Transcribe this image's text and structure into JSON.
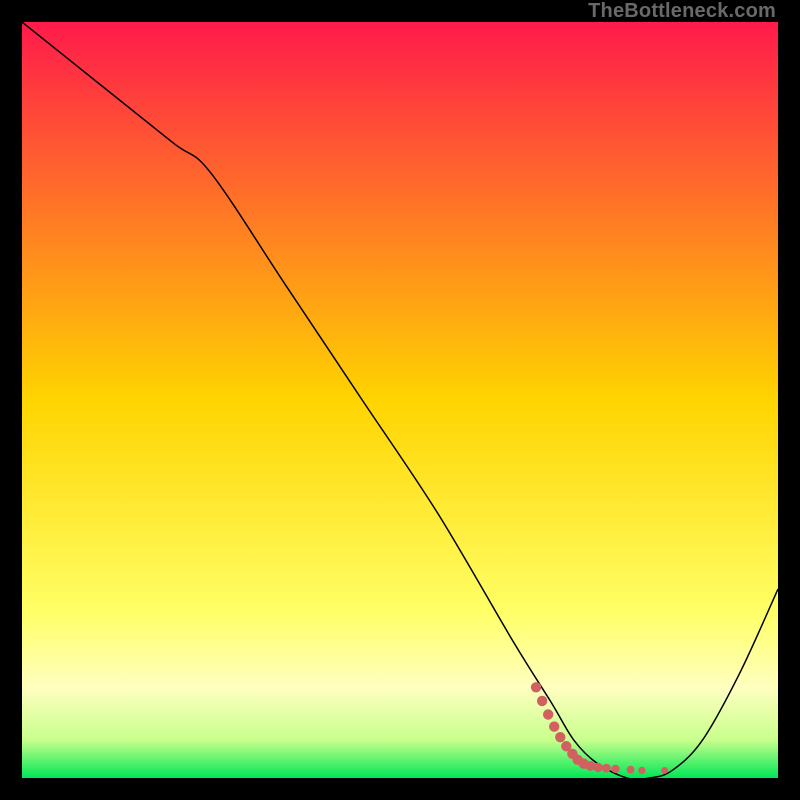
{
  "watermark": "TheBottleneck.com",
  "chart_data": {
    "type": "line",
    "title": "",
    "xlabel": "",
    "ylabel": "",
    "xlim": [
      0,
      100
    ],
    "ylim": [
      0,
      100
    ],
    "grid": false,
    "legend": false,
    "background_gradient": {
      "stops": [
        {
          "offset": 0.0,
          "color": "#ff1a4b"
        },
        {
          "offset": 0.5,
          "color": "#ffd400"
        },
        {
          "offset": 0.78,
          "color": "#ffff66"
        },
        {
          "offset": 0.88,
          "color": "#ffffc0"
        },
        {
          "offset": 0.95,
          "color": "#c8ff8c"
        },
        {
          "offset": 1.0,
          "color": "#00e756"
        }
      ]
    },
    "series": [
      {
        "name": "bottleneck-curve",
        "stroke": "#000000",
        "stroke_width": 1.5,
        "x": [
          0,
          10,
          20,
          25,
          35,
          45,
          55,
          65,
          70,
          73,
          76,
          80,
          83,
          86,
          90,
          95,
          100
        ],
        "y": [
          100,
          92,
          84,
          80,
          65,
          50,
          35,
          18,
          10,
          5,
          2,
          0,
          0,
          1,
          5,
          14,
          25
        ]
      },
      {
        "name": "optimal-marker",
        "type": "scatter",
        "stroke": "#d16060",
        "points": [
          {
            "x": 68.0,
            "y": 12.0,
            "r": 4.0
          },
          {
            "x": 68.8,
            "y": 10.2,
            "r": 4.0
          },
          {
            "x": 69.6,
            "y": 8.4,
            "r": 4.0
          },
          {
            "x": 70.4,
            "y": 6.8,
            "r": 4.0
          },
          {
            "x": 71.2,
            "y": 5.4,
            "r": 4.0
          },
          {
            "x": 72.0,
            "y": 4.2,
            "r": 4.0
          },
          {
            "x": 72.8,
            "y": 3.2,
            "r": 4.0
          },
          {
            "x": 73.5,
            "y": 2.4,
            "r": 4.0
          },
          {
            "x": 74.3,
            "y": 1.9,
            "r": 4.0
          },
          {
            "x": 75.2,
            "y": 1.6,
            "r": 3.8
          },
          {
            "x": 76.2,
            "y": 1.4,
            "r": 3.6
          },
          {
            "x": 77.3,
            "y": 1.3,
            "r": 3.4
          },
          {
            "x": 78.5,
            "y": 1.2,
            "r": 3.2
          },
          {
            "x": 80.5,
            "y": 1.1,
            "r": 3.0
          },
          {
            "x": 82.0,
            "y": 1.0,
            "r": 2.8
          },
          {
            "x": 85.0,
            "y": 1.0,
            "r": 2.6
          }
        ]
      }
    ]
  }
}
